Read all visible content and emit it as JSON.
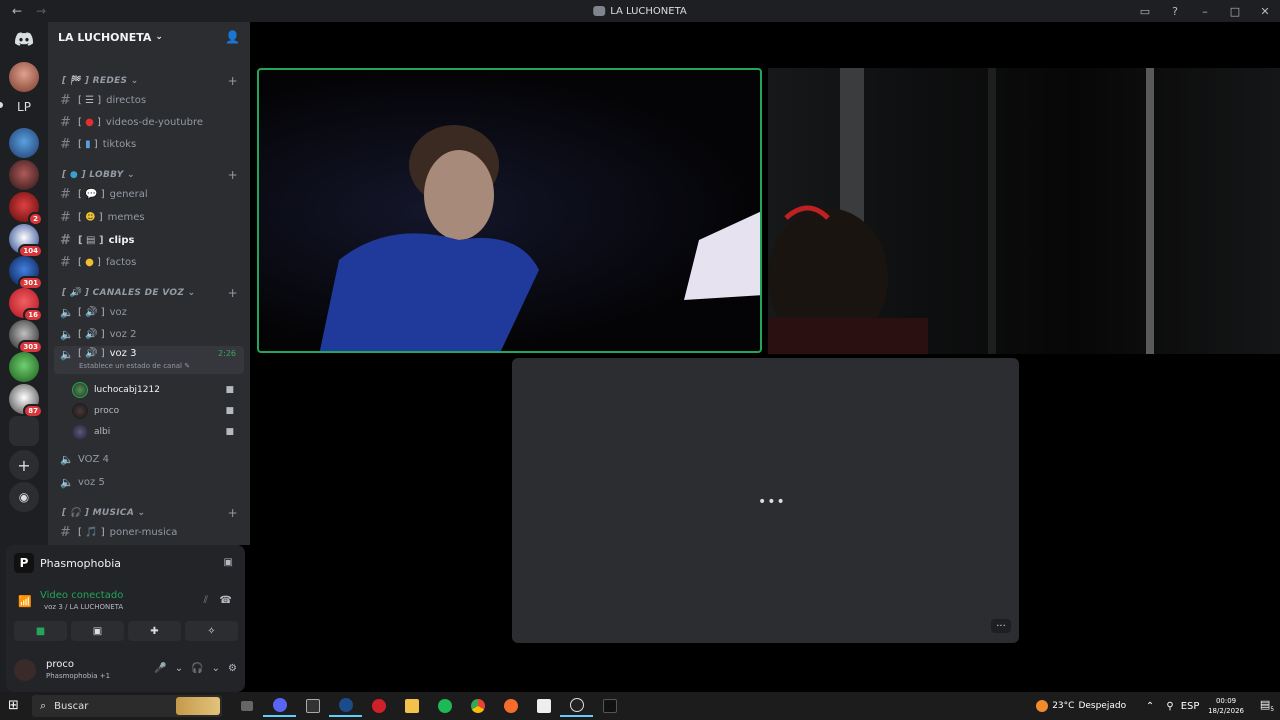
{
  "window": {
    "title": "LA LUCHONETA",
    "back_icon": "arrow-left-icon",
    "forward_icon": "arrow-right-icon",
    "controls": [
      "inbox-icon",
      "help-icon",
      "minimize-icon",
      "maximize-icon",
      "close-icon"
    ]
  },
  "rail": {
    "lp_label": "LP",
    "badges": [
      "2",
      "104",
      "301",
      "16",
      "303",
      "87"
    ]
  },
  "server": {
    "name": "LA LUCHONETA",
    "categories": [
      {
        "name": "REDES"
      },
      {
        "name": "LOBBY"
      },
      {
        "name": "CANALES DE VOZ"
      },
      {
        "name": "MUSICA"
      }
    ],
    "text_channels": {
      "directos": "directos",
      "videos": "videos-de-youtubre",
      "tiktoks": "tiktoks",
      "general": "general",
      "memes": "memes",
      "clips": "clips",
      "factos": "factos",
      "poner_musica": "poner-musica"
    },
    "voice_channels": {
      "voz": "voz",
      "voz2": "voz 2",
      "voz3": "voz 3",
      "voz3_time": "2:26",
      "voz3_status": "Establece un estado de canal",
      "voz4": "VOZ 4",
      "voz5": "voz 5"
    },
    "members": [
      {
        "name": "luchocabj1212"
      },
      {
        "name": "proco"
      },
      {
        "name": "albi"
      }
    ]
  },
  "panel": {
    "activity": "Phasmophobia",
    "voice_status": "Video conectado",
    "voice_location": "voz 3 / LA LUCHONETA",
    "user_name": "proco",
    "user_sub": "Phasmophobia +1"
  },
  "stage": {
    "loading_dots": "•••",
    "more_label": "···"
  },
  "taskbar": {
    "search_label": "Buscar",
    "temp": "23°C",
    "weather": "Despejado",
    "lang": "ESP",
    "time": "00:09",
    "date": "18/2/2026",
    "notifications": "5"
  },
  "colors": {
    "accent_green": "#23a55a",
    "badge_red": "#da373c",
    "sidebar_bg": "#2b2d31",
    "rail_bg": "#1e1f22"
  }
}
